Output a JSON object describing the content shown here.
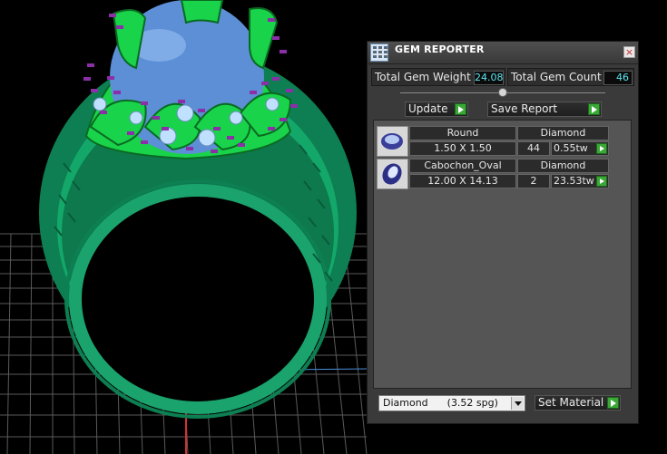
{
  "panel": {
    "title": "GEM REPORTER",
    "total_weight_label": "Total Gem Weight",
    "total_weight_value": "24.08",
    "total_count_label": "Total Gem Count",
    "total_count_value": "46",
    "update_label": "Update",
    "save_report_label": "Save Report",
    "gems": [
      {
        "shape": "Round",
        "material": "Diamond",
        "size": "1.50 X 1.50",
        "count": "44",
        "weight": "0.55tw"
      },
      {
        "shape": "Cabochon_Oval",
        "material": "Diamond",
        "size": "12.00 X 14.13",
        "count": "2",
        "weight": "23.53tw"
      }
    ],
    "material_select": "Diamond      (3.52 spg)",
    "set_material_label": "Set Material"
  },
  "colors": {
    "ring": "#13a86a",
    "prongs": "#19d34a",
    "center_stone": "#5c8fd6",
    "gem_pins": "#8b2ea8",
    "go_button": "#3aa836",
    "value_text": "#5ee6f0"
  }
}
